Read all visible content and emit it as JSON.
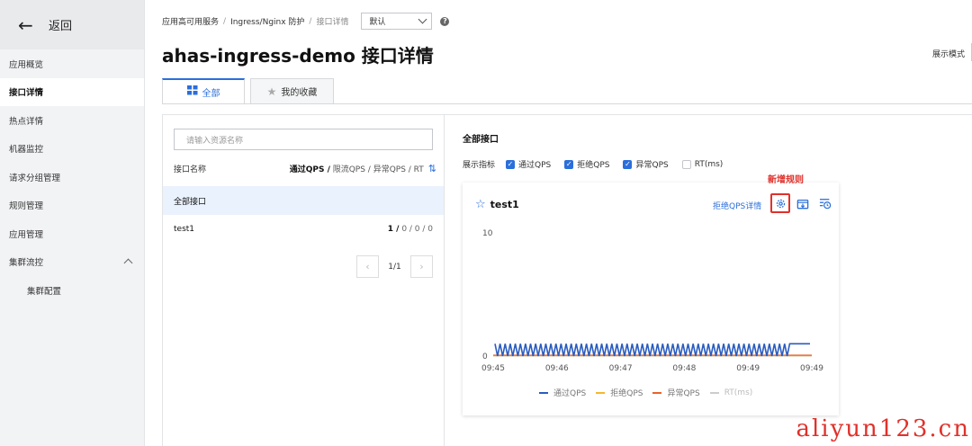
{
  "sidebar": {
    "back_label": "返回",
    "items": [
      {
        "label": "应用概览",
        "active": false
      },
      {
        "label": "接口详情",
        "active": true
      },
      {
        "label": "热点详情",
        "active": false
      },
      {
        "label": "机器监控",
        "active": false
      },
      {
        "label": "请求分组管理",
        "active": false
      },
      {
        "label": "规则管理",
        "active": false
      },
      {
        "label": "应用管理",
        "active": false
      },
      {
        "label": "集群流控",
        "active": false,
        "expanded": true
      }
    ],
    "sub_items": [
      {
        "label": "集群配置"
      }
    ]
  },
  "breadcrumb": {
    "items": [
      "应用高可用服务",
      "Ingress/Nginx 防护",
      "接口详情"
    ],
    "separator": "/",
    "namespace_select": "默认",
    "help": "?"
  },
  "header": {
    "title": "ahas-ingress-demo 接口详情",
    "view_mode": "展示模式"
  },
  "tabs": [
    {
      "label": "全部",
      "active": true,
      "icon": "grid-icon"
    },
    {
      "label": "我的收藏",
      "active": false,
      "icon": "star-icon"
    }
  ],
  "left_panel": {
    "search_placeholder": "请输入资源名称",
    "col_name": "接口名称",
    "col_metrics_bold": "通过QPS /",
    "col_metrics_rest": " 限流QPS / 异常QPS / RT",
    "rows": [
      {
        "name": "全部接口",
        "stats_bold": "",
        "stats_rest": "",
        "selected": true
      },
      {
        "name": "test1",
        "stats_bold": "1 /",
        "stats_rest": " 0 / 0 / 0",
        "selected": false
      }
    ],
    "pagination": {
      "prev": "‹",
      "page": "1/1",
      "next": "›"
    }
  },
  "right_panel": {
    "title": "全部接口",
    "metrics_label": "展示指标",
    "metrics": [
      {
        "label": "通过QPS",
        "checked": true
      },
      {
        "label": "拒绝QPS",
        "checked": true
      },
      {
        "label": "异常QPS",
        "checked": true
      },
      {
        "label": "RT(ms)",
        "checked": false
      }
    ],
    "card": {
      "title": "test1",
      "link": "拒绝QPS详情",
      "annotation": "新增规则",
      "icons": [
        "gear-icon",
        "export-icon",
        "history-icon"
      ]
    }
  },
  "chart_data": {
    "type": "line",
    "x_ticks": [
      "09:45",
      "09:46",
      "09:47",
      "09:48",
      "09:49",
      "09:49"
    ],
    "y_ticks": [
      0,
      10
    ],
    "ylim": [
      0,
      10
    ],
    "series": [
      {
        "name": "通过QPS",
        "color": "#2a5cbf",
        "pattern": "oscillating 0-1 until final segment, then steady 1",
        "values": [
          1,
          0,
          1,
          0,
          1,
          0,
          1,
          0,
          1,
          0,
          1,
          0,
          1,
          0,
          1,
          0,
          1,
          0,
          1,
          0,
          1,
          0,
          1,
          0,
          1,
          0,
          1,
          0,
          1,
          0,
          1,
          0,
          1,
          0,
          1,
          0,
          1,
          0,
          1,
          0,
          1,
          0,
          1,
          0,
          1,
          0,
          1,
          0,
          1,
          0,
          1,
          0,
          1,
          0,
          1,
          0,
          1,
          0,
          1,
          0,
          1,
          0,
          1,
          0,
          1,
          0,
          1,
          0,
          1,
          0,
          1,
          0,
          1,
          0,
          1,
          0,
          1,
          0,
          1,
          0,
          1,
          0,
          1,
          0,
          1,
          0,
          1,
          0,
          1,
          0,
          1,
          0,
          1,
          0,
          1,
          0,
          1,
          0,
          1,
          0,
          1,
          0,
          1,
          0,
          1,
          0,
          1,
          0,
          1,
          0,
          1,
          0,
          1,
          0,
          1,
          0,
          1,
          1,
          1,
          1,
          1,
          1,
          1,
          1,
          1
        ]
      },
      {
        "name": "拒绝QPS",
        "color": "#f5b82e",
        "values": [
          0
        ]
      },
      {
        "name": "异常QPS",
        "color": "#e8632b",
        "values": [
          0
        ]
      },
      {
        "name": "RT(ms)",
        "color": "#bbbbbb",
        "values": []
      }
    ]
  },
  "watermark": "aliyun123.cn"
}
